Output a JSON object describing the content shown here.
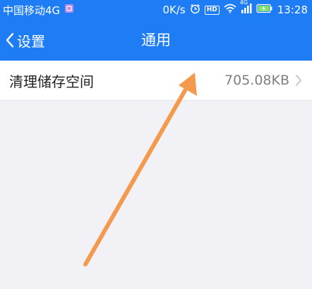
{
  "status_bar": {
    "carrier": "中国移动4G",
    "net_speed": "0K/s",
    "hd_badge": "HD",
    "network_type": "4G",
    "time": "13:28",
    "icons": [
      "sim-card-icon",
      "alarm-clock-icon",
      "hd-voice-icon",
      "wifi-icon",
      "cell-signal-icon",
      "battery-charging-icon"
    ]
  },
  "header": {
    "back_label": "设置",
    "title": "通用",
    "background_color": "#1e7df5"
  },
  "settings": {
    "clear_storage_label": "清理储存空间",
    "clear_storage_value": "705.08KB"
  },
  "annotation": {
    "arrow_color": "#f39a4f"
  }
}
